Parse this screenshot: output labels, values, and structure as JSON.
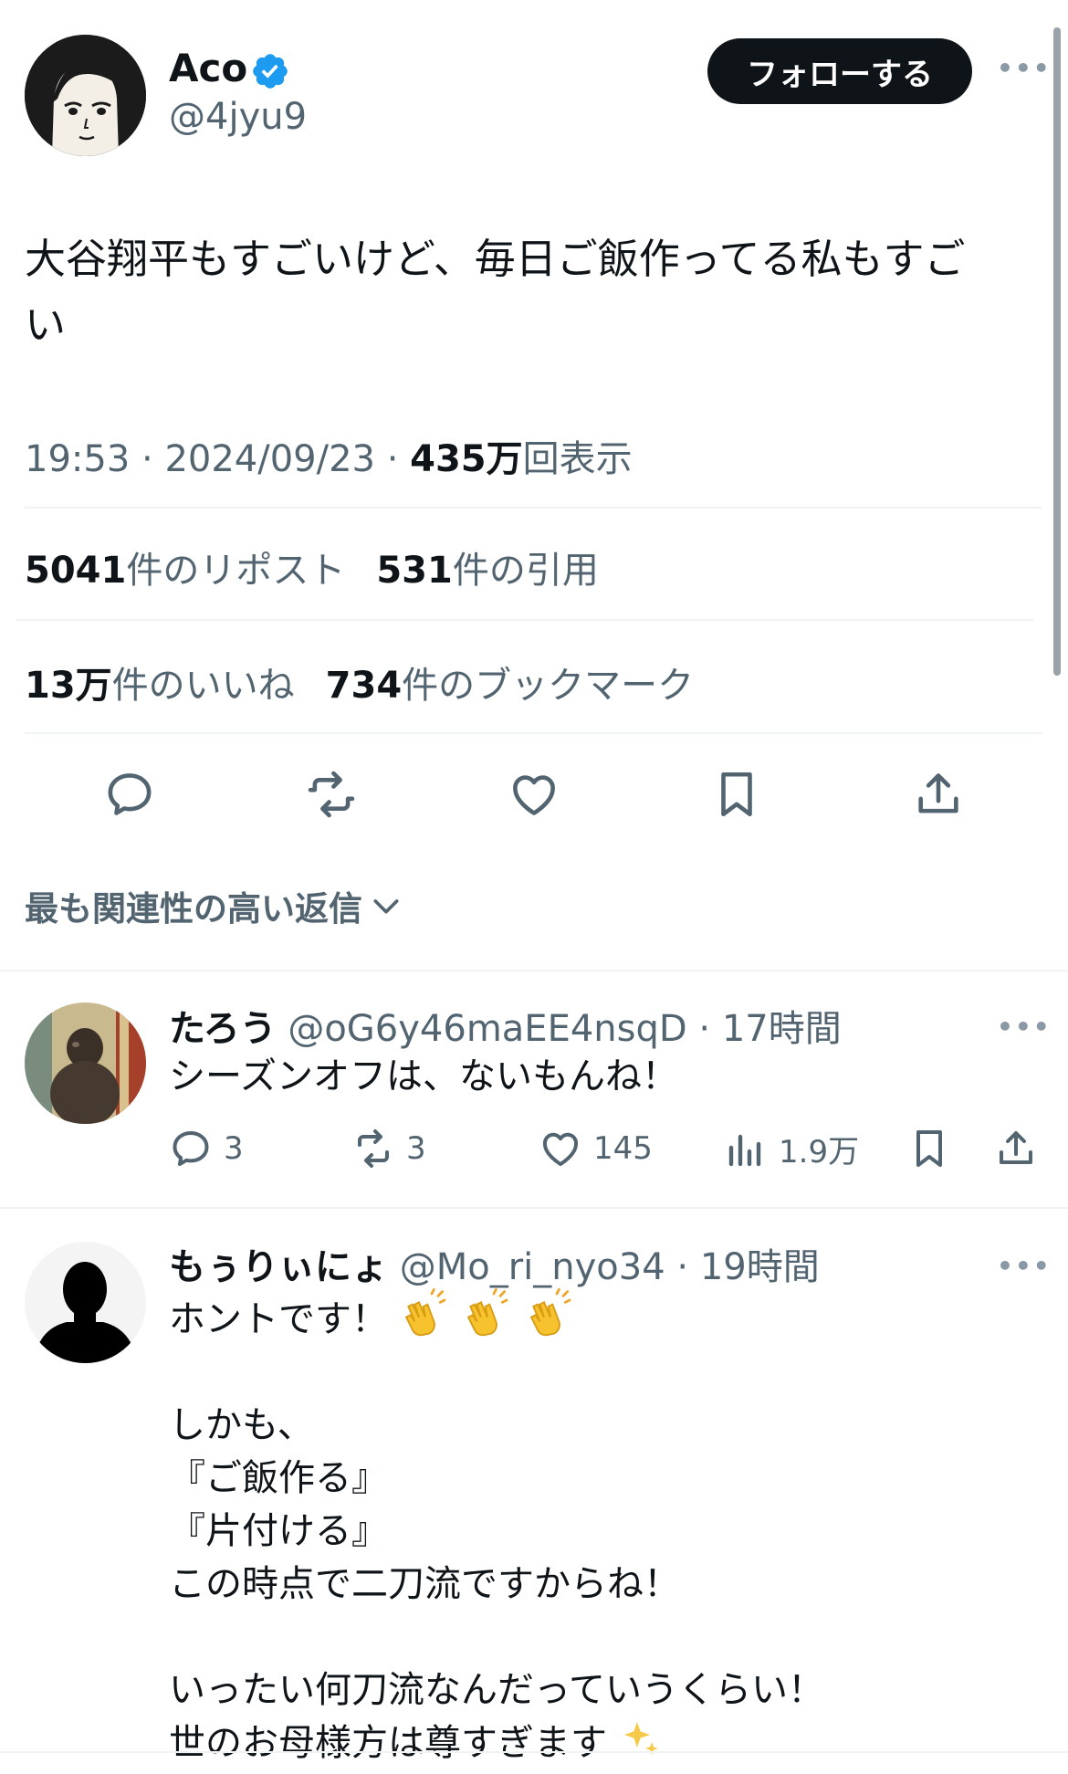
{
  "tweet": {
    "author_name": "Aco",
    "author_handle": "@4jyu9",
    "follow_label": "フォローする",
    "text": "大谷翔平もすごいけど、毎日ご飯作ってる私もすご\nい",
    "time": "19:53",
    "date": "2024/09/23",
    "views_count": "435万",
    "views_label": "回表示",
    "reposts_count": "5041",
    "reposts_label": "件のリポスト",
    "quotes_count": "531",
    "quotes_label": "件の引用",
    "likes_count": "13万",
    "likes_label": "件のいいね",
    "bookmarks_count": "734",
    "bookmarks_label": "件のブックマーク"
  },
  "sort_label": "最も関連性の高い返信",
  "replies": [
    {
      "name": "たろう",
      "handle": "@oG6y46maEE4nsqD",
      "time": "17時間",
      "text": "シーズンオフは、ないもんね！",
      "replies": "3",
      "reposts": "3",
      "likes": "145",
      "views": "1.9万"
    },
    {
      "name": "もぅりぃにょ",
      "handle": "@Mo_ri_nyo34",
      "time": "19時間",
      "line1": "ホントです！",
      "line2": "しかも、",
      "line3": "『ご飯作る』",
      "line4": "『片付ける』",
      "line5": "この時点で二刀流ですからね！",
      "line6": "いったい何刀流なんだっていうくらい！",
      "line7": "世のお母様方は尊すぎます"
    }
  ],
  "icons": [
    "verified-badge-icon",
    "more-icon",
    "reply-icon",
    "repost-icon",
    "like-icon",
    "bookmark-icon",
    "share-icon",
    "views-icon",
    "chevron-down-icon",
    "clap-emoji-icon",
    "sparkles-emoji-icon"
  ],
  "colors": {
    "accent": "#1d9bf0",
    "text": "#0f1419",
    "muted": "#536471",
    "divider": "#eff3f4"
  }
}
